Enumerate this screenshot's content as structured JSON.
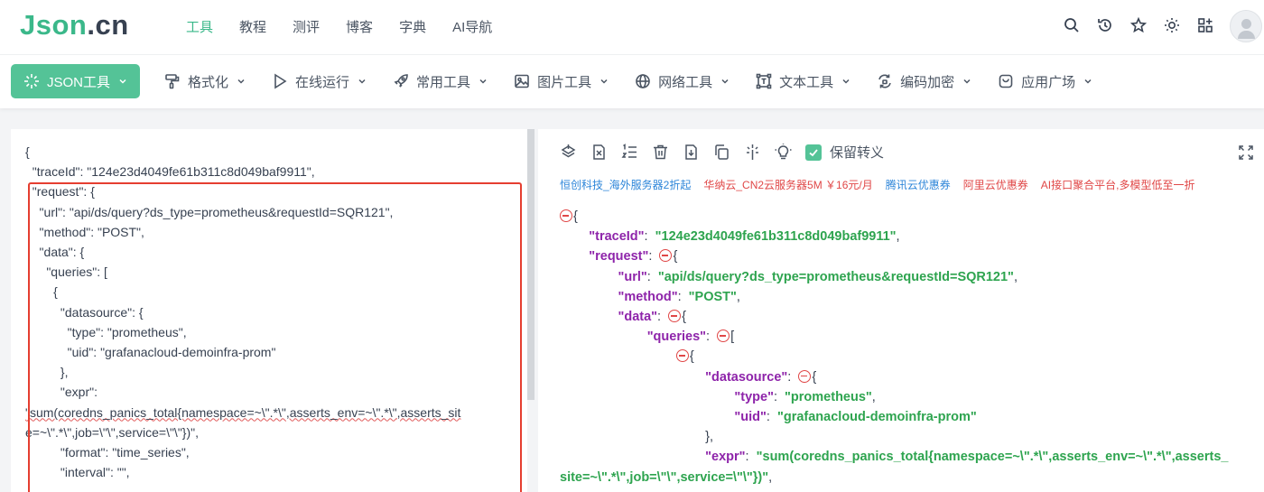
{
  "logo": {
    "part1": "Json",
    "part2": ".cn"
  },
  "topnav": [
    {
      "label": "工具",
      "active": true
    },
    {
      "label": "教程"
    },
    {
      "label": "测评"
    },
    {
      "label": "博客"
    },
    {
      "label": "字典"
    },
    {
      "label": "AI导航"
    }
  ],
  "top_icons": [
    "search-icon",
    "history-icon",
    "star-icon",
    "sun-icon",
    "apps-icon",
    "user-avatar"
  ],
  "toolbar": [
    {
      "label": "JSON工具",
      "icon": "sparkle-icon"
    },
    {
      "label": "格式化",
      "icon": "paint-roller-icon"
    },
    {
      "label": "在线运行",
      "icon": "play-icon"
    },
    {
      "label": "常用工具",
      "icon": "rocket-icon"
    },
    {
      "label": "图片工具",
      "icon": "image-icon"
    },
    {
      "label": "网络工具",
      "icon": "globe-icon"
    },
    {
      "label": "文本工具",
      "icon": "text-frame-icon"
    },
    {
      "label": "编码加密",
      "icon": "refresh-lock-icon"
    },
    {
      "label": "应用广场",
      "icon": "app-store-icon"
    }
  ],
  "right_toolbar": {
    "icons": [
      "layers-icon",
      "delete-file-icon",
      "sort-list-icon",
      "trash-icon",
      "download-icon",
      "copy-icon",
      "magic-icon",
      "bulb-icon"
    ],
    "keep_escape_label": "保留转义",
    "keep_escape_checked": true
  },
  "ads": [
    "恒创科技_海外服务器2折起",
    "华纳云_CN2云服务器5M ￥16元/月",
    "腾讯云优惠券",
    "阿里云优惠券",
    "AI接口聚合平台,多模型低至一折"
  ],
  "input_lines": [
    "{",
    "  \"traceId\": \"124e23d4049fe61b311c8d049baf9911\",",
    "  \"request\": {",
    "    \"url\": \"api/ds/query?ds_type=prometheus&requestId=SQR121\",",
    "    \"method\": \"POST\",",
    "    \"data\": {",
    "      \"queries\": [",
    "        {",
    "          \"datasource\": {",
    "            \"type\": \"prometheus\",",
    "            \"uid\": \"grafanacloud-demoinfra-prom\"",
    "          },",
    "          \"expr\":",
    "\"sum(coredns_panics_total{namespace=~\\\".*\\\",asserts_env=~\\\".*\\\",asserts_sit",
    "e=~\\\".*\\\",job=\\\"\\\",service=\\\"\\\"})\",",
    "          \"format\": \"time_series\",",
    "          \"interval\": \"\","
  ],
  "output": {
    "traceId_key": "\"traceId\"",
    "traceId_val": "\"124e23d4049fe61b311c8d049baf9911\"",
    "request_key": "\"request\"",
    "url_key": "\"url\"",
    "url_val": "\"api/ds/query?ds_type=prometheus&requestId=SQR121\"",
    "method_key": "\"method\"",
    "method_val": "\"POST\"",
    "data_key": "\"data\"",
    "queries_key": "\"queries\"",
    "datasource_key": "\"datasource\"",
    "type_key": "\"type\"",
    "type_val": "\"prometheus\"",
    "uid_key": "\"uid\"",
    "uid_val": "\"grafanacloud-demoinfra-prom\"",
    "expr_key": "\"expr\"",
    "expr_val_1": "\"sum(coredns_panics_total{namespace=~\\\".*\\\",asserts_env=~\\\".*\\\",asserts_",
    "expr_val_2": "site=~\\\".*\\\",job=\\\"\\\",service=\\\"\\\"})\""
  },
  "colors": {
    "accent": "#54c397",
    "key": "#8e24aa",
    "string": "#2ea44f",
    "highlight_box": "#e53e30"
  }
}
